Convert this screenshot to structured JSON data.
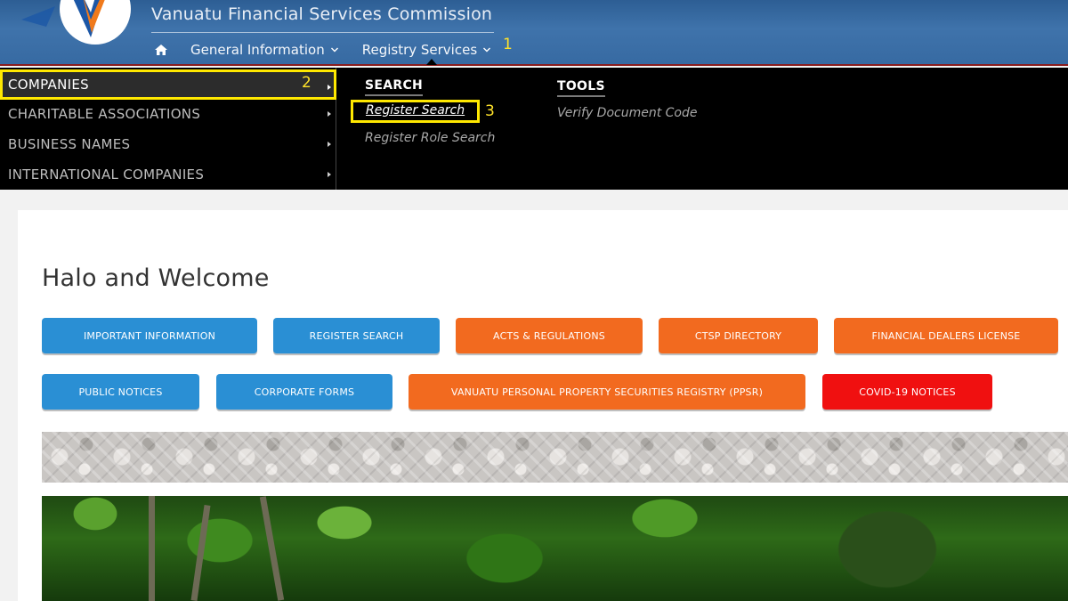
{
  "header": {
    "brand_name": "Vanuatu Financial Services Commission",
    "nav": [
      {
        "label": "General Information"
      },
      {
        "label": "Registry Services"
      }
    ],
    "callouts": [
      "1",
      "2",
      "3"
    ]
  },
  "mega_menu": {
    "side_items": [
      {
        "label": "COMPANIES"
      },
      {
        "label": "CHARITABLE ASSOCIATIONS"
      },
      {
        "label": "BUSINESS NAMES"
      },
      {
        "label": "INTERNATIONAL COMPANIES"
      }
    ],
    "columns": [
      {
        "heading": "SEARCH",
        "links": [
          "Register Search",
          "Register Role Search"
        ]
      },
      {
        "heading": "TOOLS",
        "links": [
          "Verify Document Code"
        ]
      }
    ]
  },
  "main": {
    "title": "Halo and Welcome",
    "buttons_row1": [
      {
        "label": "IMPORTANT INFORMATION"
      },
      {
        "label": "REGISTER SEARCH"
      },
      {
        "label": "ACTS & REGULATIONS"
      },
      {
        "label": "CTSP DIRECTORY"
      },
      {
        "label": "FINANCIAL DEALERS LICENSE"
      }
    ],
    "buttons_row2": [
      {
        "label": "PUBLIC NOTICES"
      },
      {
        "label": "CORPORATE FORMS"
      },
      {
        "label": "VANUATU PERSONAL PROPERTY SECURITIES REGISTRY (PPSR)"
      },
      {
        "label": "COVID-19 NOTICES"
      }
    ]
  },
  "colors": {
    "header_blue": "#376aa2",
    "button_blue": "#2a8fd4",
    "button_orange": "#f26a1f",
    "button_red": "#f01010",
    "highlight_yellow": "#ffe800"
  }
}
